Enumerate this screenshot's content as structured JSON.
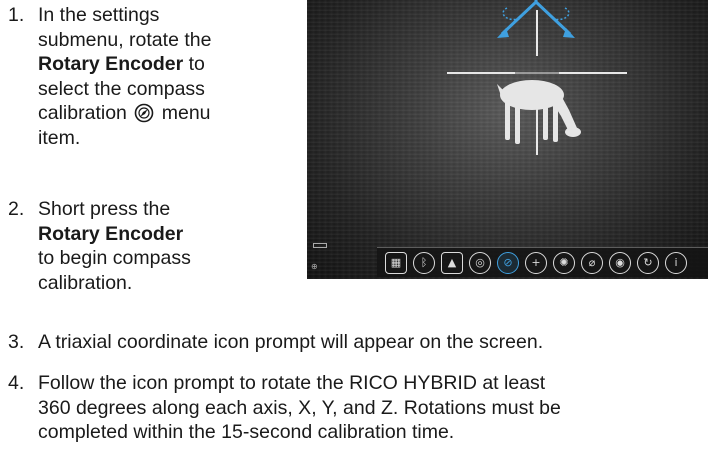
{
  "steps": [
    {
      "number": "1.",
      "lines": [
        "In the settings",
        "submenu, rotate the",
        "Rotary Encoder",
        " to",
        "select the compass",
        "calibration",
        " menu",
        "item."
      ]
    },
    {
      "number": "2.",
      "lines": [
        "Short press the",
        "Rotary Encoder",
        "to begin compass",
        "calibration."
      ]
    },
    {
      "number": "3.",
      "text": "A triaxial coordinate icon prompt will appear on the screen."
    },
    {
      "number": "4.",
      "lines": [
        "Follow the icon prompt to rotate the RICO HYBRID at least",
        "360 degrees along each axis, X, Y, and Z. Rotations must be",
        "completed within the 15-second calibration time."
      ]
    }
  ],
  "screen": {
    "menu_icons": [
      "keyboard-icon",
      "bluetooth-icon",
      "image-icon",
      "target-icon",
      "compass-icon",
      "crosshair-plus-icon",
      "sun-icon",
      "zero-icon",
      "wifi-icon",
      "refresh-icon",
      "info-icon"
    ],
    "selected_icon": "compass-icon",
    "accent_color": "#3fa0e0"
  }
}
